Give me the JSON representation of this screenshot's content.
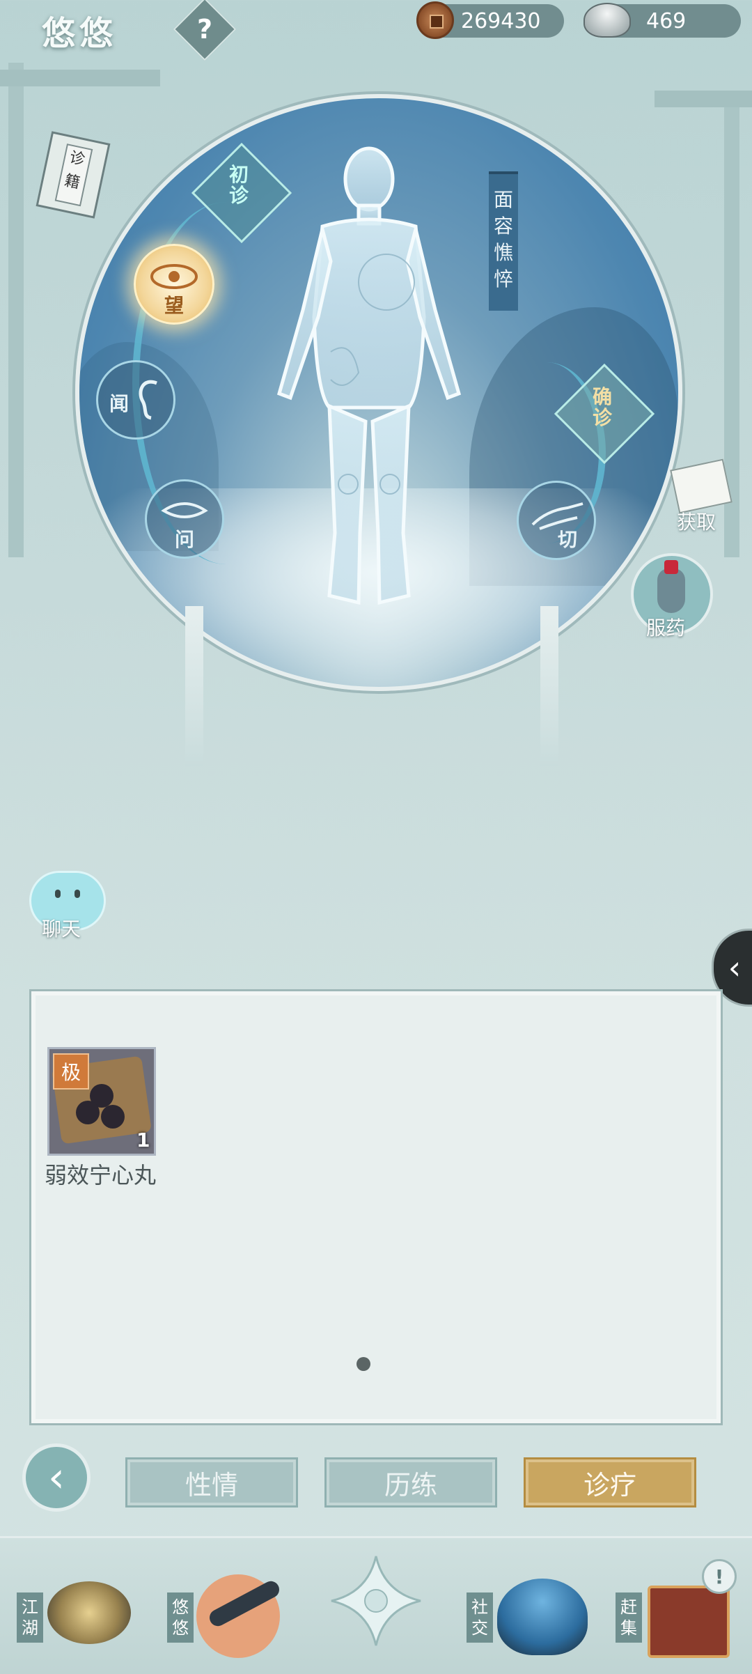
{
  "header": {
    "title": "悠悠",
    "help_glyph": "?",
    "copper": "269430",
    "silver": "469"
  },
  "diagnosis": {
    "book_label": "诊籍",
    "initial_label": "初诊",
    "confirm_label": "确诊",
    "face_status": "面容憔悴",
    "senses": [
      "望",
      "闻",
      "问",
      "切"
    ]
  },
  "side": {
    "obtain_label": "获取",
    "medicine_label": "服药",
    "chat_label": "聊天"
  },
  "inventory": {
    "items": [
      {
        "name": "弱效宁心丸",
        "grade": "极",
        "count": "1"
      }
    ]
  },
  "tabs": [
    {
      "label": "性情",
      "active": false
    },
    {
      "label": "历练",
      "active": false
    },
    {
      "label": "诊疗",
      "active": true
    }
  ],
  "bottom_nav": [
    "江湖",
    "悠悠",
    "社交",
    "赶集"
  ],
  "colors": {
    "accent_gold": "#c9a660",
    "teal": "#85b3b3",
    "disc_blue": "#4d86b0"
  }
}
